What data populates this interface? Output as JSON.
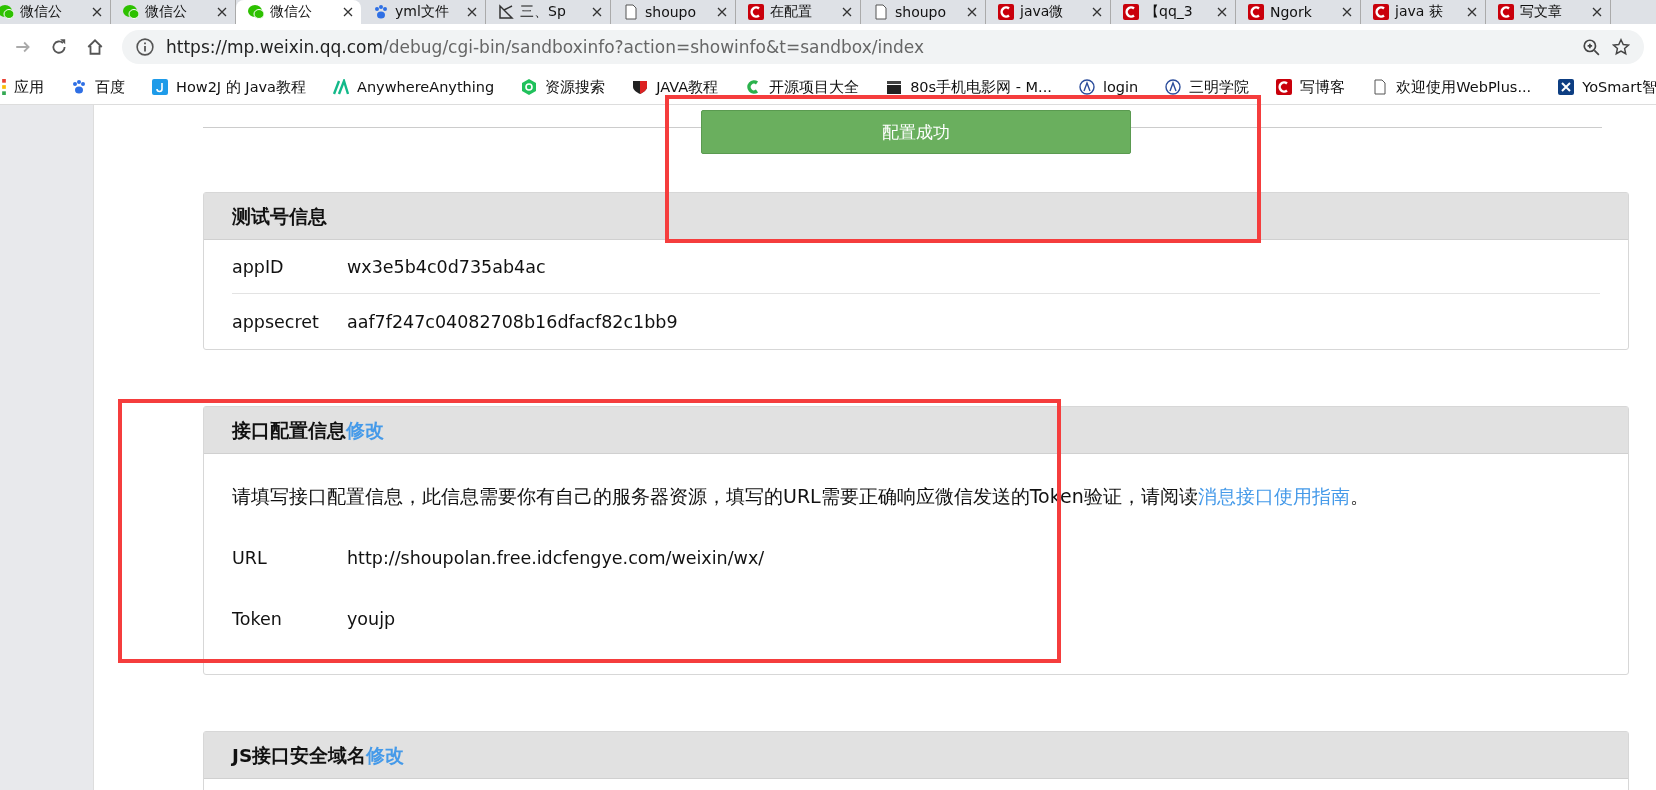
{
  "tabs": [
    {
      "title": "微信公",
      "selected": false
    },
    {
      "title": "微信公",
      "selected": false
    },
    {
      "title": "微信公",
      "selected": true
    },
    {
      "title": "yml文件",
      "selected": false
    },
    {
      "title": "三、Sp",
      "selected": false
    },
    {
      "title": "shoupo",
      "selected": false
    },
    {
      "title": "在配置",
      "selected": false
    },
    {
      "title": "shoupo",
      "selected": false
    },
    {
      "title": "java微",
      "selected": false
    },
    {
      "title": "【qq_3",
      "selected": false
    },
    {
      "title": "Ngork",
      "selected": false
    },
    {
      "title": "java 获",
      "selected": false
    },
    {
      "title": "写文章",
      "selected": false
    }
  ],
  "address_bar": {
    "host": "https://mp.weixin.qq.com",
    "path": "/debug/cgi-bin/sandboxinfo?action=showinfo&t=sandbox/index"
  },
  "bookmarks": [
    {
      "label": "应用"
    },
    {
      "label": "百度"
    },
    {
      "label": "How2J 的 Java教程"
    },
    {
      "label": "AnywhereAnything"
    },
    {
      "label": "资源搜索"
    },
    {
      "label": "JAVA教程"
    },
    {
      "label": "开源项目大全"
    },
    {
      "label": "80s手机电影网 - M..."
    },
    {
      "label": "login"
    },
    {
      "label": "三明学院"
    },
    {
      "label": "写博客"
    },
    {
      "label": "欢迎使用WebPlus..."
    },
    {
      "label": "YoSmart智"
    }
  ],
  "status_button": "配置成功",
  "panels": [
    {
      "title": "测试号信息",
      "kind": "fields",
      "rows": [
        {
          "label": "appID",
          "value": "wx3e5b4c0d735ab4ac"
        },
        {
          "label": "appsecret",
          "value": "aaf7f247c04082708b16dfacf82c1bb9"
        }
      ]
    },
    {
      "title": "接口配置信息",
      "edit_link": "修改",
      "kind": "config",
      "intro": "请填写接口配置信息，此信息需要你有自己的服务器资源，填写的URL需要正确响应微信发送的Token验证，请阅读",
      "intro_link": "消息接口使用指南",
      "intro_end": "。",
      "rows": [
        {
          "label": "URL",
          "value": "http://shoupolan.free.idcfengye.com/weixin/wx/"
        },
        {
          "label": "Token",
          "value": "youjp"
        }
      ]
    },
    {
      "title": "JS接口安全域名",
      "edit_link": "修改",
      "kind": "cut"
    }
  ]
}
